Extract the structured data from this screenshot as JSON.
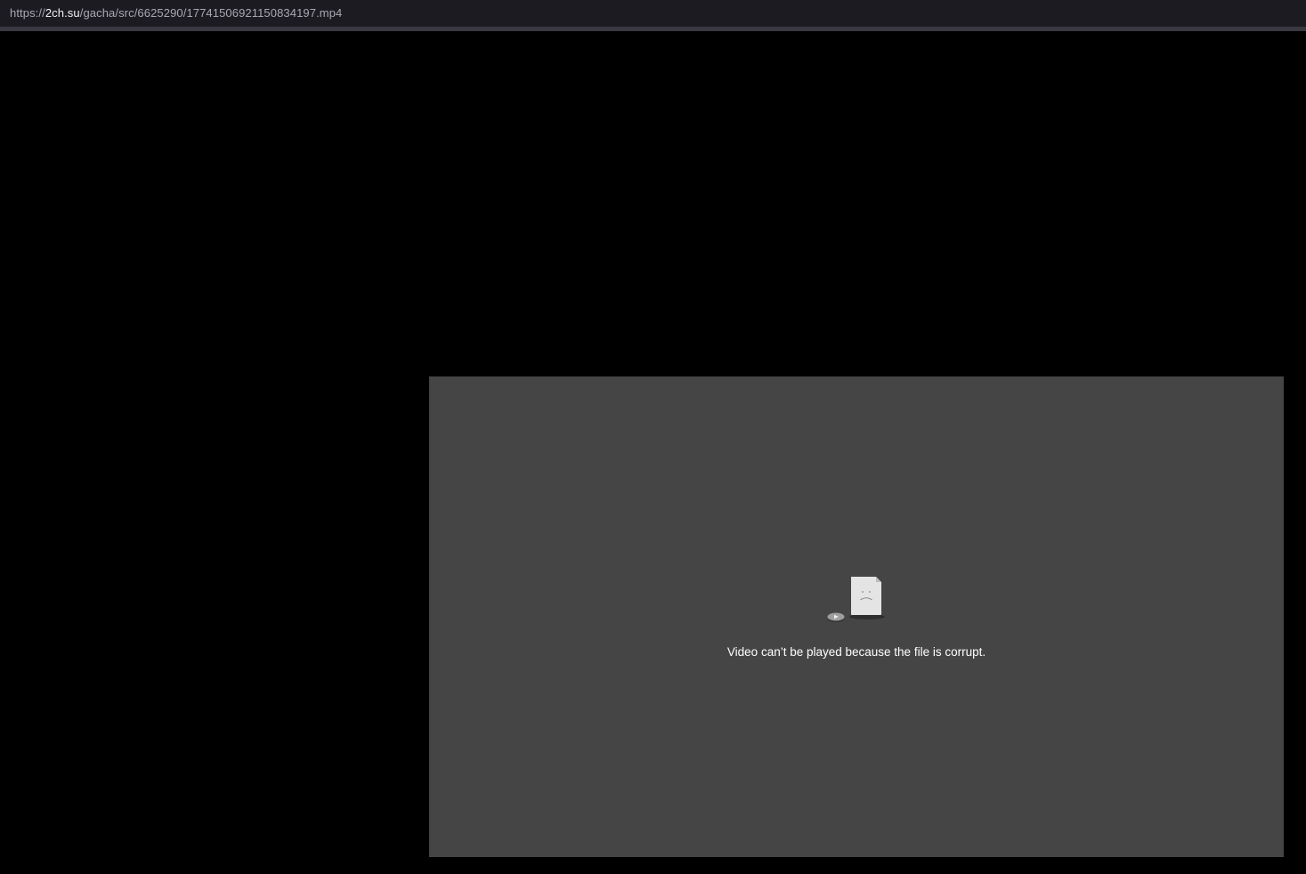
{
  "address_bar": {
    "scheme": "https://",
    "host": "2ch.su",
    "path": "/gacha/src/6625290/17741506921150834197.mp4"
  },
  "video_player": {
    "error_message": "Video can’t be played because the file is corrupt.",
    "error_icon": "broken-file-icon"
  },
  "colors": {
    "page_background": "#000000",
    "toolbar_background": "#1c1b22",
    "video_panel_background": "#454545",
    "message_text": "#ffffff"
  }
}
